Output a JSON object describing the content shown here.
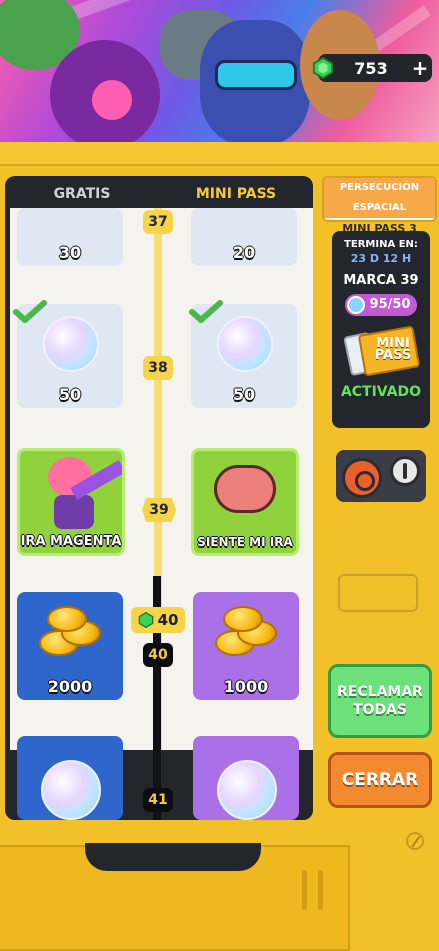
{
  "currency": {
    "gems": "753",
    "add_label": "+"
  },
  "columns": {
    "free": "GRATIS",
    "pass": "MINI PASS"
  },
  "event": {
    "name": "PERSECUCIÓN ESPACIAL",
    "pass_name": "MINI PASS 3"
  },
  "info": {
    "ends_label": "TERMINA EN:",
    "time_left": "23 D 12 H",
    "marca": "MARCA 39",
    "progress_text": "95/50",
    "progress_fraction": 1,
    "pass_icon_text": "MINI PASS",
    "status": "ACTIVADO"
  },
  "tiers": [
    {
      "number": "37",
      "free": {
        "label": "30",
        "type": "pale"
      },
      "pass": {
        "label": "20",
        "type": "pale"
      }
    },
    {
      "number": "38",
      "free": {
        "label": "50",
        "type": "pale",
        "claimed": true
      },
      "pass": {
        "label": "50",
        "type": "pale",
        "claimed": true
      }
    },
    {
      "number": "39",
      "free": {
        "label": "IRA MAGENTA",
        "type": "green"
      },
      "pass": {
        "label": "SIENTE MI IRA",
        "type": "green"
      }
    },
    {
      "number": "40",
      "free": {
        "label": "2000",
        "type": "blue"
      },
      "pass": {
        "label": "1000",
        "type": "purple"
      },
      "gem_cost": "40"
    },
    {
      "number": "41",
      "free": {
        "label": "",
        "type": "blue"
      },
      "pass": {
        "label": "",
        "type": "purple"
      }
    }
  ],
  "buttons": {
    "claim_all": "RECLAMAR TODAS",
    "close": "CERRAR"
  },
  "colors": {
    "machine": "#f2c12a",
    "panel": "#23262d",
    "claim": "#6ce07a",
    "close": "#f38a30",
    "active": "#5fe45b"
  }
}
